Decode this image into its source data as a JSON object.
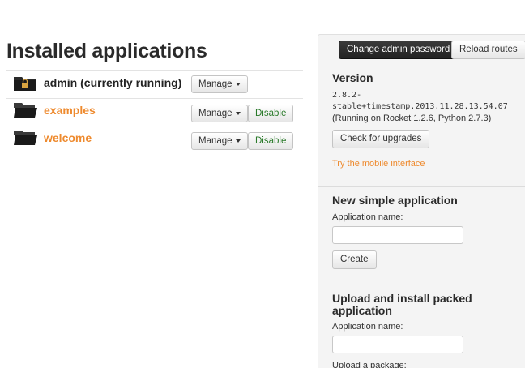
{
  "main": {
    "title": "Installed applications",
    "apps": [
      {
        "name": "admin (currently running)",
        "manage_label": "Manage",
        "locked": true
      },
      {
        "name": "examples",
        "manage_label": "Manage",
        "disable_label": "Disable"
      },
      {
        "name": "welcome",
        "manage_label": "Manage",
        "disable_label": "Disable"
      }
    ]
  },
  "sidebar": {
    "change_password_label": "Change admin password",
    "reload_routes_label": "Reload routes",
    "version": {
      "heading": "Version",
      "line1": "2.8.2-",
      "line2": "stable+timestamp.2013.11.28.13.54.07",
      "running": "(Running on Rocket 1.2.6, Python 2.7.3)",
      "check_upgrades_label": "Check for upgrades",
      "mobile_link": "Try the mobile interface"
    },
    "new_app": {
      "heading": "New simple application",
      "name_label": "Application name:",
      "name_value": "",
      "create_label": "Create"
    },
    "upload": {
      "heading_line1": "Upload and install packed",
      "heading_line2": "application",
      "name_label": "Application name:",
      "name_value": "",
      "package_label": "Upload a package:"
    }
  },
  "colors": {
    "link": "#ee8a2e",
    "disable": "#2a7a2a",
    "dark_button": "#222222",
    "sidebar_bg": "#f4f4f4"
  }
}
